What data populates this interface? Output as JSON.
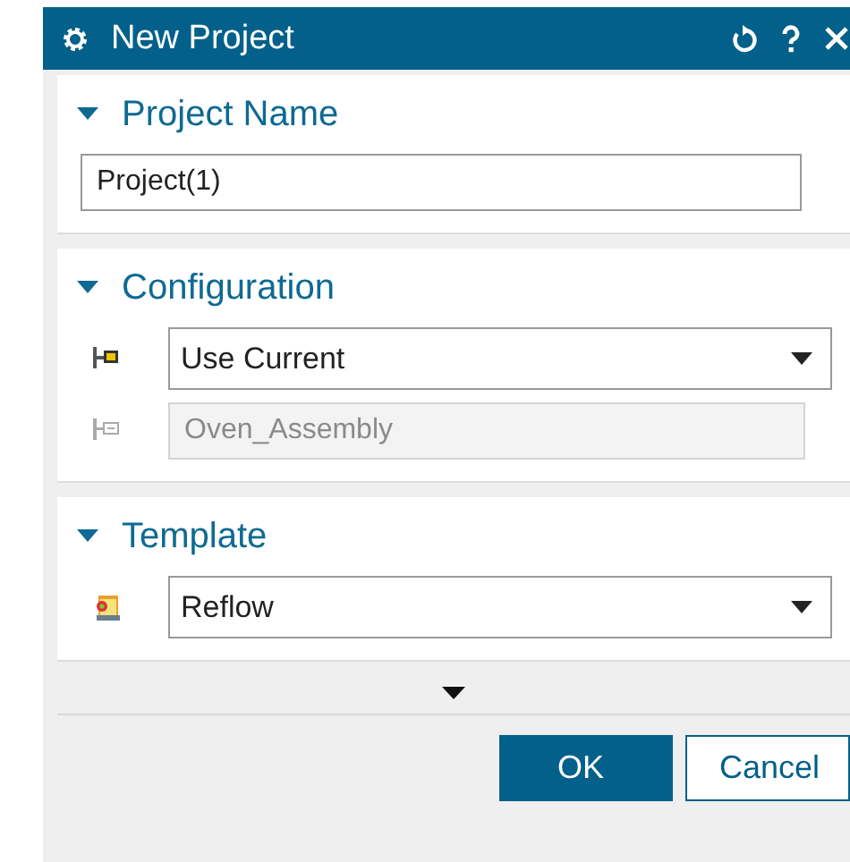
{
  "window": {
    "title": "New Project"
  },
  "sections": [
    {
      "title": "Project Name",
      "expanded": true,
      "fields": [
        {
          "kind": "text",
          "value": "Project(1)",
          "disabled": false
        }
      ]
    },
    {
      "title": "Configuration",
      "expanded": true,
      "fields": [
        {
          "kind": "dropdown",
          "value": "Use Current",
          "disabled": false
        },
        {
          "kind": "text",
          "value": "Oven_Assembly",
          "disabled": true
        }
      ]
    },
    {
      "title": "Template",
      "expanded": true,
      "fields": [
        {
          "kind": "dropdown",
          "value": "Reflow",
          "disabled": false
        }
      ]
    }
  ],
  "buttons": [
    {
      "label": "OK",
      "primary": true
    },
    {
      "label": "Cancel",
      "primary": false
    }
  ]
}
